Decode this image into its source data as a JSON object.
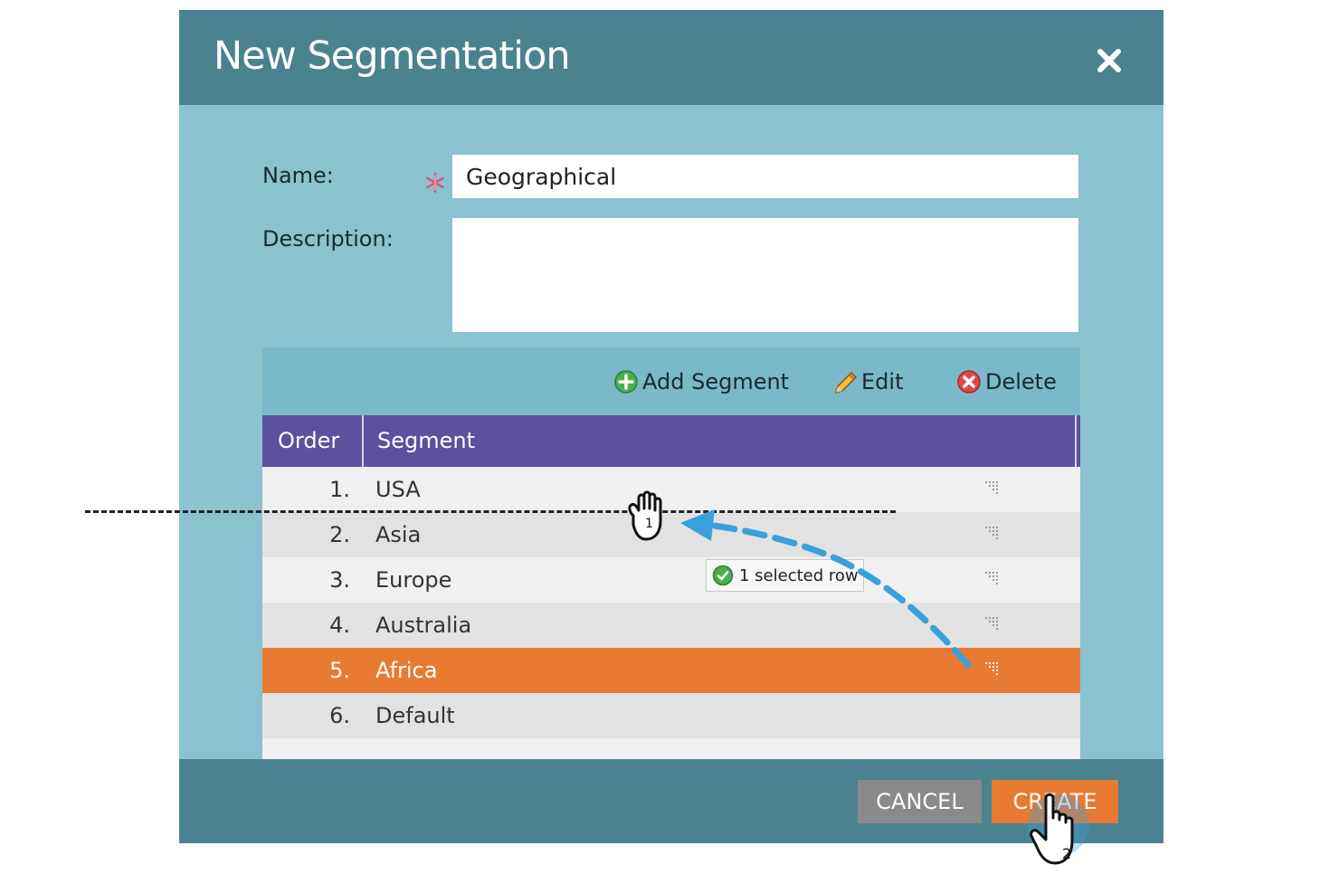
{
  "dialog": {
    "title": "New Segmentation",
    "close_icon": "close-icon"
  },
  "form": {
    "name_label": "Name:",
    "name_value": "Geographical",
    "required_icon": "asterisk-icon",
    "description_label": "Description:",
    "description_value": ""
  },
  "toolbar": {
    "add_label": "Add Segment",
    "add_icon": "plus-circle-icon",
    "edit_label": "Edit",
    "edit_icon": "pencil-icon",
    "delete_label": "Delete",
    "delete_icon": "x-circle-icon"
  },
  "grid": {
    "columns": [
      "Order",
      "Segment"
    ],
    "rows": [
      {
        "order": "1.",
        "segment": "USA",
        "selected": false
      },
      {
        "order": "2.",
        "segment": "Asia",
        "selected": false
      },
      {
        "order": "3.",
        "segment": "Europe",
        "selected": false
      },
      {
        "order": "4.",
        "segment": "Australia",
        "selected": false
      },
      {
        "order": "5.",
        "segment": "Africa",
        "selected": true
      },
      {
        "order": "6.",
        "segment": "Default",
        "selected": false
      }
    ],
    "drag_tooltip": "1 selected row",
    "drag_tooltip_icon": "check-circle-icon"
  },
  "footer": {
    "cancel_label": "CANCEL",
    "create_label": "CREATE"
  },
  "annotations": {
    "step_1": "1",
    "step_2": "2"
  },
  "colors": {
    "header": "#4a8290",
    "body": "#8bc2cf",
    "grid_header": "#5b519e",
    "selected_row": "#e87a33",
    "arrow": "#3aa0dc"
  }
}
